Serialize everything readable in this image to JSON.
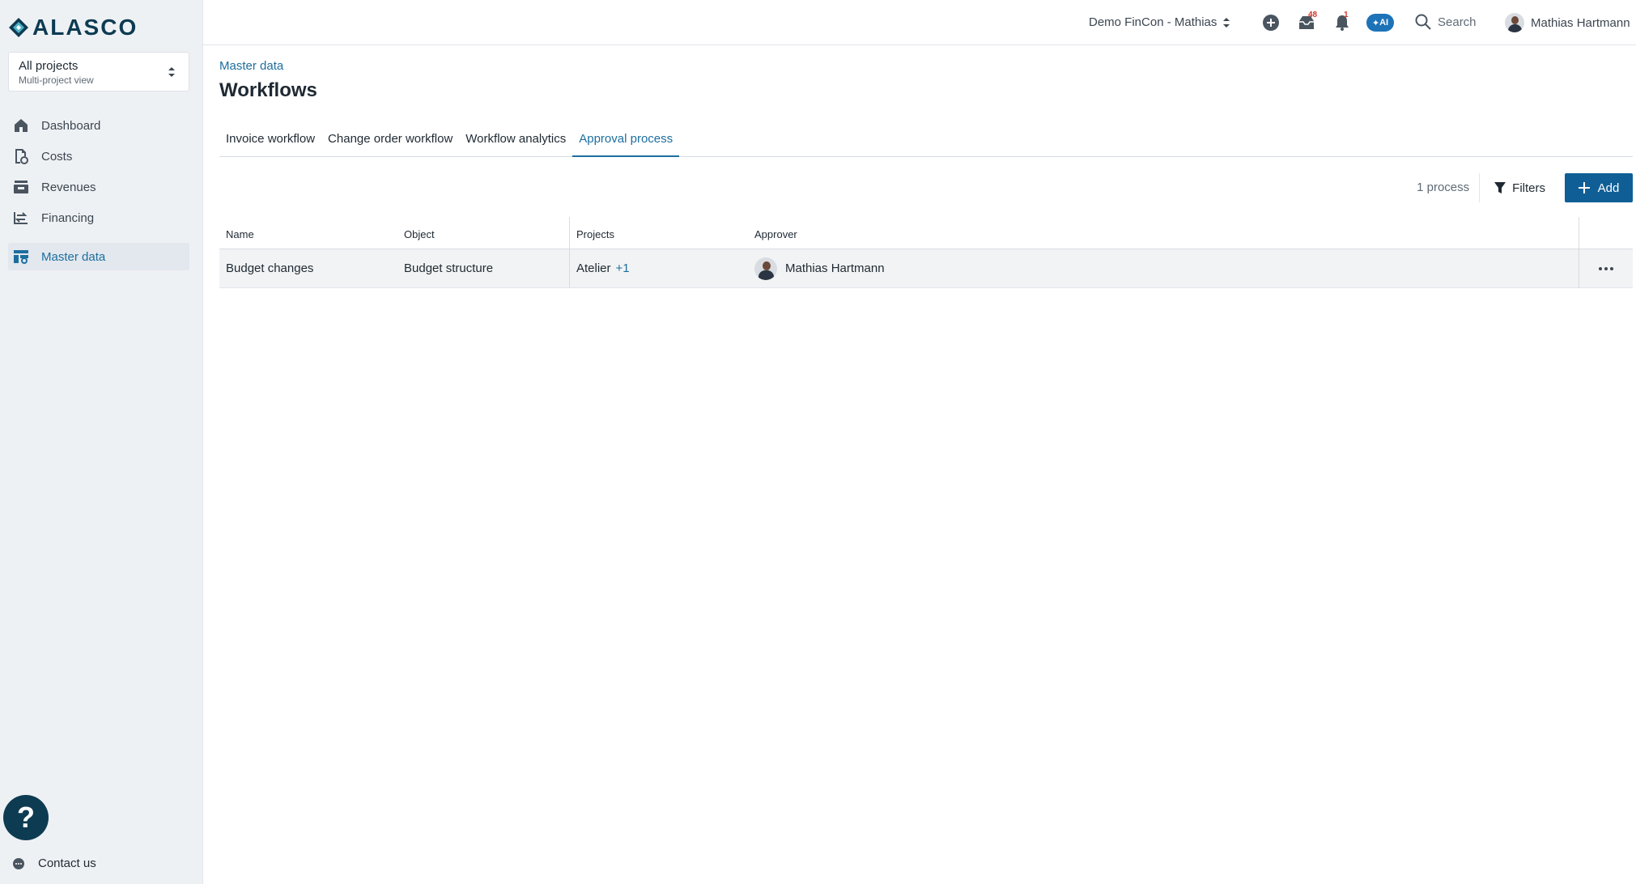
{
  "brand": {
    "name": "ALASCO"
  },
  "project_selector": {
    "title": "All projects",
    "subtitle": "Multi-project view"
  },
  "sidebar": {
    "items": [
      {
        "label": "Dashboard",
        "icon": "home-icon"
      },
      {
        "label": "Costs",
        "icon": "costs-icon"
      },
      {
        "label": "Revenues",
        "icon": "revenues-icon"
      },
      {
        "label": "Financing",
        "icon": "financing-icon"
      },
      {
        "label": "Master data",
        "icon": "master-data-icon",
        "active": true
      }
    ],
    "help_label": "?",
    "contact_label": "Contact us"
  },
  "topbar": {
    "company": "Demo FinCon - Mathias",
    "inbox_badge": "48",
    "notifications_badge": "1",
    "ai_label": "AI",
    "search_label": "Search",
    "user_name": "Mathias Hartmann"
  },
  "page": {
    "breadcrumb": "Master data",
    "title": "Workflows",
    "tabs": [
      {
        "label": "Invoice workflow"
      },
      {
        "label": "Change order workflow"
      },
      {
        "label": "Workflow analytics"
      },
      {
        "label": "Approval process",
        "active": true
      }
    ],
    "process_count": "1 process",
    "filters_label": "Filters",
    "add_label": "Add"
  },
  "table": {
    "columns": [
      "Name",
      "Object",
      "Projects",
      "Approver"
    ],
    "rows": [
      {
        "name": "Budget changes",
        "object": "Budget structure",
        "project": "Atelier",
        "extra_projects": "+1",
        "approver": "Mathias Hartmann"
      }
    ]
  },
  "colors": {
    "accent": "#1c6e9e",
    "primary_button": "#0f5f96",
    "brand_dark": "#0d3b52",
    "badge": "#d9342b"
  }
}
